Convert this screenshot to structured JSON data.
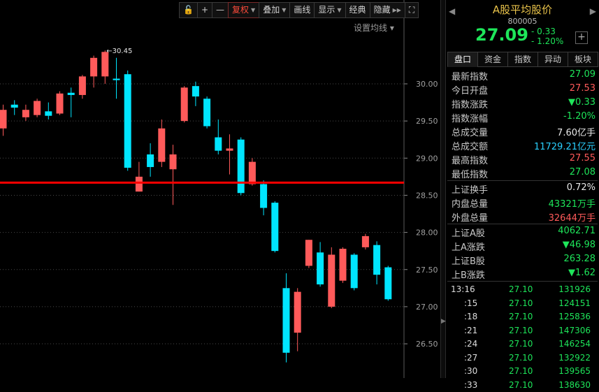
{
  "toolbar": {
    "lock": "🔓",
    "zoom_in": "+",
    "zoom_out": "—",
    "buttons": [
      "复权",
      "叠加",
      "画线",
      "显示",
      "经典",
      "隐藏"
    ],
    "fullscreen": "⛶"
  },
  "ma_setting": "设置均线 ▾",
  "chart_data": {
    "type": "candlestick",
    "y_ticks": [
      "30.00",
      "29.50",
      "29.00",
      "28.50",
      "28.00",
      "27.50",
      "27.00",
      "26.50"
    ],
    "ylim": [
      26.3,
      30.8
    ],
    "max_label": "←30.45",
    "reference_line": 28.67,
    "candles": [
      {
        "o": 29.4,
        "c": 29.65,
        "h": 29.72,
        "l": 29.3
      },
      {
        "o": 29.72,
        "c": 29.68,
        "h": 29.78,
        "l": 29.58
      },
      {
        "o": 29.55,
        "c": 29.65,
        "h": 29.72,
        "l": 29.5
      },
      {
        "o": 29.58,
        "c": 29.77,
        "h": 29.8,
        "l": 29.55
      },
      {
        "o": 29.63,
        "c": 29.57,
        "h": 29.75,
        "l": 29.52
      },
      {
        "o": 29.6,
        "c": 29.87,
        "h": 29.9,
        "l": 29.58
      },
      {
        "o": 29.88,
        "c": 29.85,
        "h": 29.95,
        "l": 29.55
      },
      {
        "o": 29.85,
        "c": 30.1,
        "h": 30.12,
        "l": 29.8
      },
      {
        "o": 30.1,
        "c": 30.35,
        "h": 30.38,
        "l": 29.95
      },
      {
        "o": 30.1,
        "c": 30.43,
        "h": 30.45,
        "l": 30.0
      },
      {
        "o": 30.07,
        "c": 30.05,
        "h": 30.35,
        "l": 29.8
      },
      {
        "o": 30.13,
        "c": 28.87,
        "h": 30.18,
        "l": 28.83
      },
      {
        "o": 28.55,
        "c": 28.75,
        "h": 28.95,
        "l": 28.55
      },
      {
        "o": 29.05,
        "c": 28.88,
        "h": 29.2,
        "l": 28.75
      },
      {
        "o": 28.95,
        "c": 29.4,
        "h": 29.52,
        "l": 28.88
      },
      {
        "o": 28.85,
        "c": 29.05,
        "h": 29.18,
        "l": 28.37
      },
      {
        "o": 29.5,
        "c": 29.95,
        "h": 29.97,
        "l": 29.48
      },
      {
        "o": 29.97,
        "c": 29.83,
        "h": 30.03,
        "l": 29.7
      },
      {
        "o": 29.8,
        "c": 29.43,
        "h": 29.83,
        "l": 29.4
      },
      {
        "o": 29.28,
        "c": 29.1,
        "h": 29.52,
        "l": 29.05
      },
      {
        "o": 29.1,
        "c": 29.13,
        "h": 29.32,
        "l": 28.78
      },
      {
        "o": 29.25,
        "c": 28.53,
        "h": 29.28,
        "l": 28.5
      },
      {
        "o": 28.65,
        "c": 28.95,
        "h": 29.0,
        "l": 28.63
      },
      {
        "o": 28.65,
        "c": 28.33,
        "h": 28.7,
        "l": 28.23
      },
      {
        "o": 28.4,
        "c": 27.75,
        "h": 28.42,
        "l": 27.73
      },
      {
        "o": 27.25,
        "c": 26.38,
        "h": 27.45,
        "l": 26.25
      },
      {
        "o": 26.65,
        "c": 27.2,
        "h": 27.25,
        "l": 26.4
      },
      {
        "o": 27.55,
        "c": 27.9,
        "h": 27.9,
        "l": 27.52
      },
      {
        "o": 27.73,
        "c": 27.3,
        "h": 27.87,
        "l": 27.27
      },
      {
        "o": 27.0,
        "c": 27.7,
        "h": 27.8,
        "l": 26.98
      },
      {
        "o": 27.35,
        "c": 27.78,
        "h": 27.8,
        "l": 27.32
      },
      {
        "o": 27.7,
        "c": 27.25,
        "h": 27.72,
        "l": 27.22
      },
      {
        "o": 27.8,
        "c": 27.95,
        "h": 27.98,
        "l": 27.77
      },
      {
        "o": 27.83,
        "c": 27.43,
        "h": 27.88,
        "l": 27.3
      },
      {
        "o": 27.53,
        "c": 27.1,
        "h": 27.55,
        "l": 27.08
      }
    ],
    "colors": {
      "up": "#ff5a5a",
      "down": "#00e5ff",
      "ref": "#ff0000",
      "grid": "#4a4a4a",
      "axis": "#8a8a8a"
    }
  },
  "panel": {
    "name": "A股平均股价",
    "code": "800005",
    "price": "27.09",
    "change": "- 0.33",
    "pct": "- 1.20%",
    "add": "+",
    "nav_left": "◀",
    "nav_right": "▶",
    "tabs": [
      "盘口",
      "资金",
      "指数",
      "异动",
      "板块"
    ]
  },
  "quotes": [
    {
      "label": "最新指数",
      "value": "27.09",
      "color": "#1ee65a"
    },
    {
      "label": "今日开盘",
      "value": "27.53",
      "color": "#ff5a5a"
    },
    {
      "label": "指数涨跌",
      "value": "▼0.33",
      "color": "#1ee65a"
    },
    {
      "label": "指数涨幅",
      "value": "-1.20%",
      "color": "#1ee65a"
    },
    {
      "label": "总成交量",
      "value": "7.60亿手",
      "color": "#e8e8e8"
    },
    {
      "label": "总成交额",
      "value": "11729.21亿元",
      "color": "#2ad0ff"
    },
    {
      "label": "最高指数",
      "value": "27.55",
      "color": "#ff5a5a"
    },
    {
      "label": "最低指数",
      "value": "27.08",
      "color": "#1ee65a"
    }
  ],
  "quotes2": [
    {
      "label": "上证换手",
      "value": "0.72%",
      "color": "#e8e8e8"
    },
    {
      "label": "内盘总量",
      "value": "43321万手",
      "color": "#1ee65a"
    },
    {
      "label": "外盘总量",
      "value": "32644万手",
      "color": "#ff5a5a"
    }
  ],
  "quotes3": [
    {
      "label": "上证A股",
      "value": "4062.71",
      "color": "#1ee65a"
    },
    {
      "label": "上A涨跌",
      "value": "▼46.98",
      "color": "#1ee65a"
    },
    {
      "label": "上证B股",
      "value": "263.28",
      "color": "#1ee65a"
    },
    {
      "label": "上B涨跌",
      "value": "▼1.62",
      "color": "#1ee65a"
    }
  ],
  "trades": [
    {
      "time": "13:16",
      "price": "27.10",
      "vol": "131926"
    },
    {
      "time": ":15",
      "price": "27.10",
      "vol": "124151"
    },
    {
      "time": ":18",
      "price": "27.10",
      "vol": "125836"
    },
    {
      "time": ":21",
      "price": "27.10",
      "vol": "147306"
    },
    {
      "time": ":24",
      "price": "27.10",
      "vol": "146254"
    },
    {
      "time": ":27",
      "price": "27.10",
      "vol": "132922"
    },
    {
      "time": ":30",
      "price": "27.10",
      "vol": "139565"
    },
    {
      "time": ":33",
      "price": "27.10",
      "vol": "138630"
    }
  ]
}
